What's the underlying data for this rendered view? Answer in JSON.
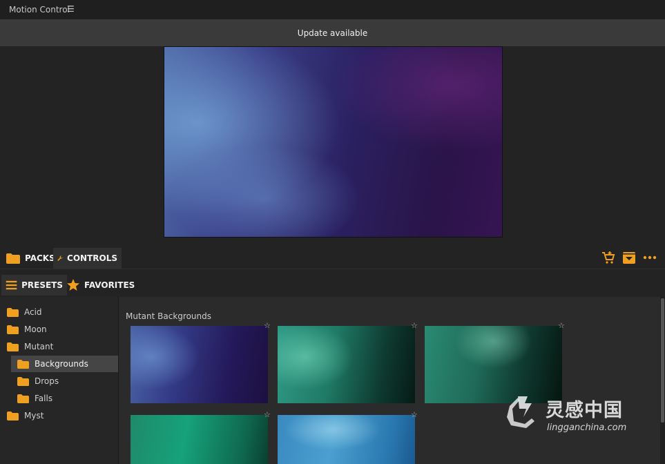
{
  "app": {
    "title": "Motion Control",
    "menu_icon": "hamburger-icon"
  },
  "banner": {
    "text": "Update available"
  },
  "main_tabs": [
    {
      "label": "PACKS",
      "icon": "folder-icon",
      "active": false
    },
    {
      "label": "CONTROLS",
      "icon": "wrench-icon",
      "active": true
    }
  ],
  "toolbar_icons": [
    "cart-add-icon",
    "download-icon",
    "more-icon"
  ],
  "sub_tabs": [
    {
      "label": "PRESETS",
      "icon": "list-icon",
      "active": true
    },
    {
      "label": "FAVORITES",
      "icon": "star-icon",
      "active": false
    }
  ],
  "sidebar": {
    "items": [
      {
        "label": "Acid",
        "level": 0
      },
      {
        "label": "Moon",
        "level": 0
      },
      {
        "label": "Mutant",
        "level": 0
      },
      {
        "label": "Backgrounds",
        "level": 1,
        "selected": true
      },
      {
        "label": "Drops",
        "level": 1
      },
      {
        "label": "Falls",
        "level": 1
      },
      {
        "label": "Myst",
        "level": 0
      }
    ]
  },
  "content": {
    "heading": "Mutant Backgrounds",
    "thumbnails": [
      {
        "name": "blue-purple-smoke"
      },
      {
        "name": "teal-smoke"
      },
      {
        "name": "green-smoke"
      },
      {
        "name": "emerald-smoke"
      },
      {
        "name": "light-blue-smoke"
      }
    ]
  },
  "watermark": {
    "cn": "灵感中国",
    "en": "lingganchina.com"
  },
  "colors": {
    "accent": "#f0a020",
    "background": "#232323",
    "banner": "#3a3a3a"
  }
}
